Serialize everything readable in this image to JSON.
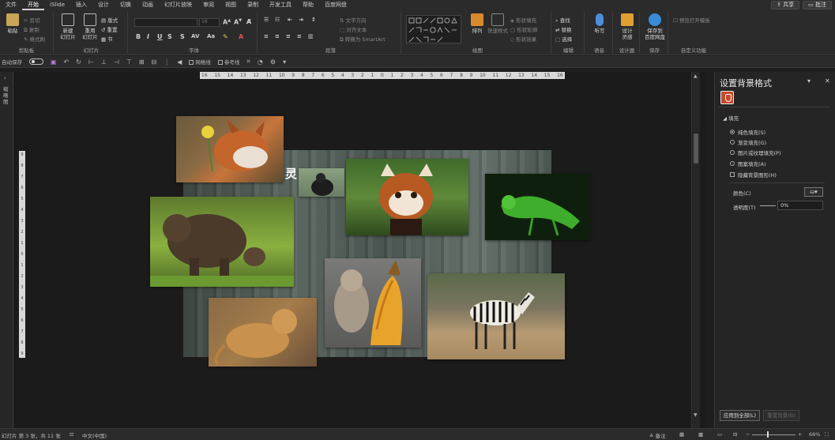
{
  "menu": {
    "items": [
      "文件",
      "开始",
      "iSlide",
      "插入",
      "设计",
      "切换",
      "动画",
      "幻灯片放映",
      "审阅",
      "视图",
      "录制",
      "开发工具",
      "帮助",
      "百度网盘"
    ],
    "active_index": 1,
    "share": "共享",
    "comments": "批注"
  },
  "ribbon": {
    "clipboard": {
      "paste": "粘贴",
      "cut": "剪切",
      "copy": "复制",
      "painter": "格式刷",
      "label": "剪贴板"
    },
    "slides": {
      "new_slide": "新建\n幻灯片",
      "reuse": "重用\n幻灯片",
      "layout": "版式",
      "reset": "重置",
      "section": "节",
      "label": "幻灯片"
    },
    "font": {
      "size": "16",
      "bold": "B",
      "italic": "I",
      "underline": "U",
      "strike": "S",
      "label": "字体"
    },
    "paragraph": {
      "text_dir": "文字方向",
      "align_text": "对齐文本",
      "smartart": "转换为 SmartArt",
      "label": "段落"
    },
    "drawing": {
      "arrange": "排列",
      "quick_styles": "快速样式",
      "shape_fill": "形状填充",
      "shape_outline": "形状轮廓",
      "shape_effect": "形状效果",
      "label": "绘图"
    },
    "editing": {
      "find": "查找",
      "replace": "替换",
      "select": "选择",
      "label": "编辑"
    },
    "voice": {
      "dictate": "听写",
      "label": "语音"
    },
    "designer": {
      "design_ideas": "设计\n灵感",
      "label": "设计器"
    },
    "save": {
      "save_baidu": "保存到\n百度网盘",
      "label": "保存"
    },
    "custom": {
      "auto_preview": "预览打开模板",
      "label": "自定义功能"
    }
  },
  "qat": {
    "autosave": "自动保存",
    "grid": "网格线",
    "ref": "参考线"
  },
  "thumbs": {
    "label": "缩略图"
  },
  "canvas": {
    "hruler": [
      "16",
      "15",
      "14",
      "13",
      "12",
      "11",
      "10",
      "9",
      "8",
      "7",
      "6",
      "5",
      "4",
      "3",
      "2",
      "1",
      "0",
      "1",
      "2",
      "3",
      "4",
      "5",
      "6",
      "7",
      "8",
      "9",
      "10",
      "11",
      "12",
      "13",
      "14",
      "15",
      "16"
    ],
    "vruler": [
      "9",
      "8",
      "7",
      "6",
      "5",
      "4",
      "3",
      "2",
      "1",
      "0",
      "1",
      "2",
      "3",
      "4",
      "5",
      "6",
      "7",
      "8",
      "9"
    ],
    "slide_char": "灵"
  },
  "pane": {
    "title": "设置背景格式",
    "fill_section": "填充",
    "options": [
      "纯色填充(S)",
      "渐变填充(G)",
      "图片或纹理填充(P)",
      "图案填充(A)"
    ],
    "selected_index": 0,
    "hide_bg": "隐藏背景图形(H)",
    "color_label": "颜色(C)",
    "transparency_label": "透明度(T)",
    "transparency_value": "0%",
    "apply_all": "应用到全部(L)",
    "reset_bg": "重置背景(B)"
  },
  "status": {
    "slide_info": "幻灯片 第 3 张，共 11 张",
    "language": "中文(中国)",
    "notes": "备注",
    "zoom": "66%"
  },
  "colors": {
    "accent": "#c8482c",
    "bg": "#1e1e1e",
    "ribbon": "#2b2b2b"
  }
}
